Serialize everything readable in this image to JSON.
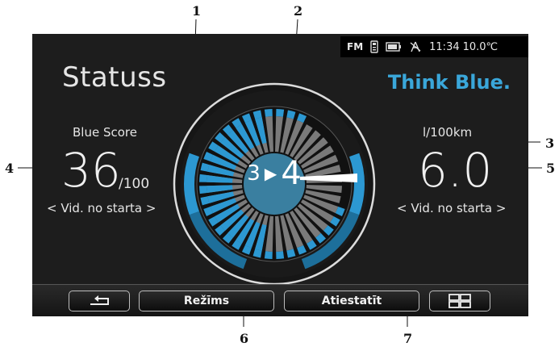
{
  "callouts": [
    "1",
    "2",
    "3",
    "4",
    "5",
    "6",
    "7"
  ],
  "status_bar": {
    "radio_band": "FM",
    "time": "11:34",
    "temperature": "10.0℃"
  },
  "page_title": "Statuss",
  "brand": "Think Blue.",
  "left_metric": {
    "label": "Blue Score",
    "value": "36",
    "suffix": "/100",
    "period": "< Vid. no starta >"
  },
  "right_metric": {
    "label": "l/100km",
    "value": "6.0",
    "period": "< Vid. no starta >"
  },
  "gauge": {
    "from_gear": "3",
    "to_gear": "4"
  },
  "toolbar": {
    "back_icon": "back-arrow-icon",
    "mode_label": "Režīms",
    "reset_label": "Atiestatīt",
    "menu_icon": "grid-menu-icon"
  },
  "colors": {
    "accent_blue": "#2c98d2",
    "dark_blue": "#1d6f9b",
    "segment_gray": "#7a7a7a",
    "brand_blue": "#3aa7da"
  }
}
